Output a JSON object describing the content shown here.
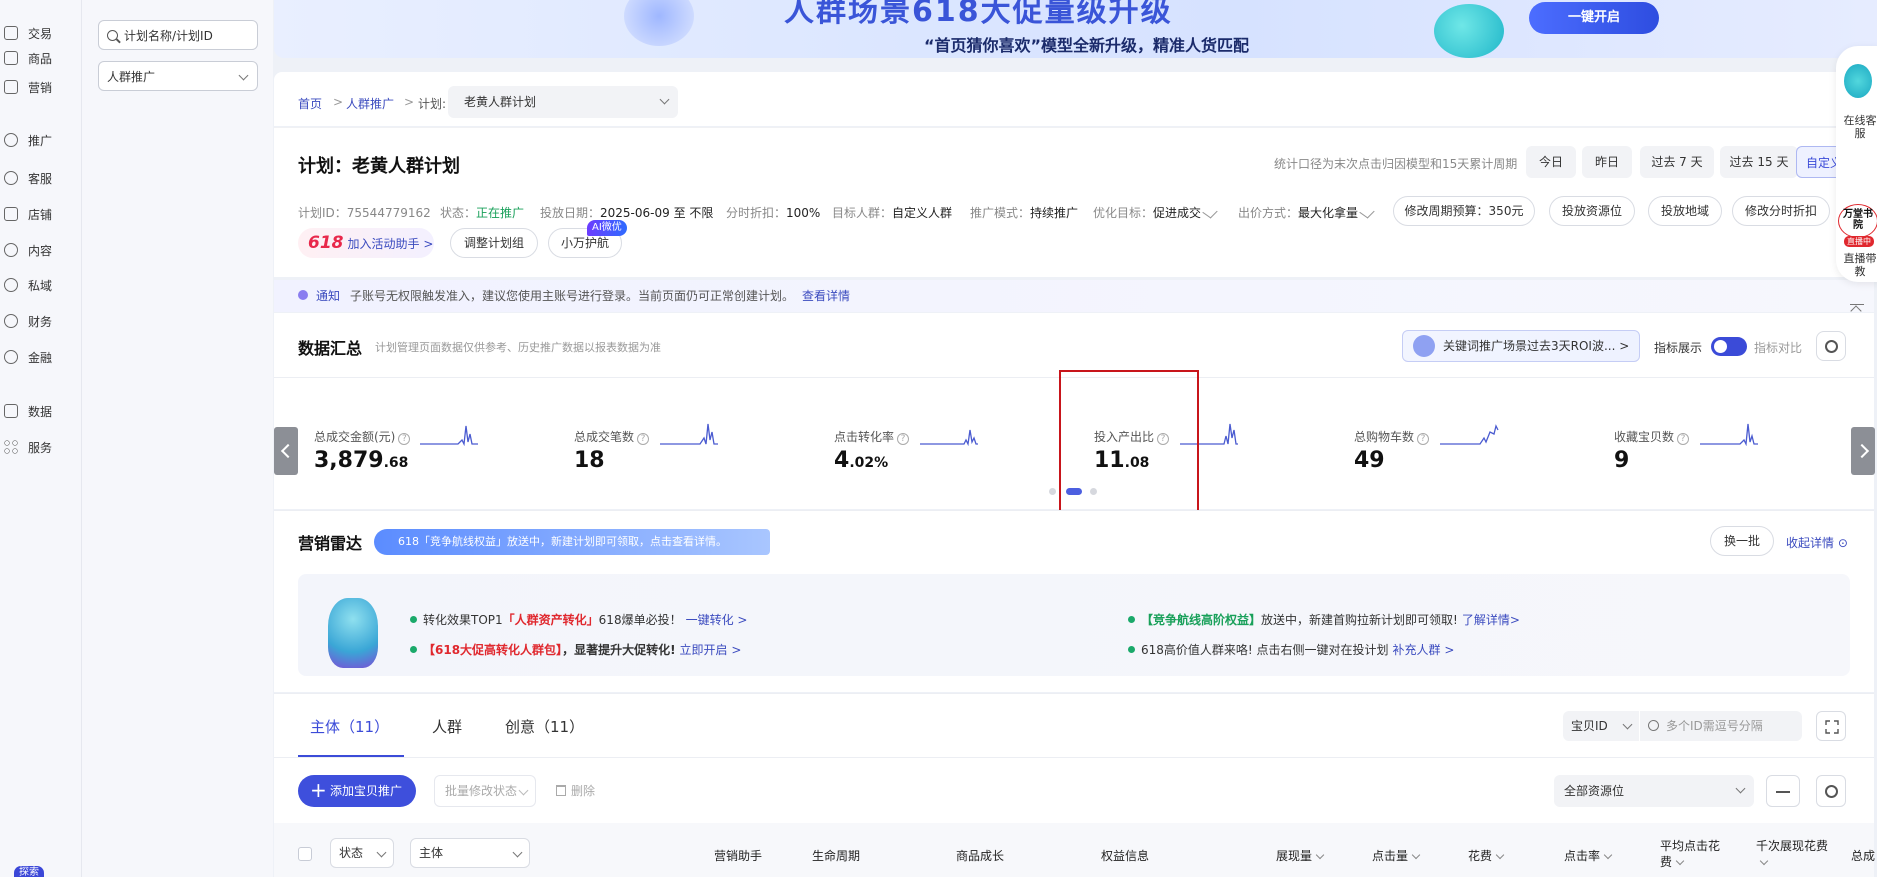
{
  "leftnav": {
    "items": [
      {
        "label": "交易",
        "icon": "receipt-icon"
      },
      {
        "label": "商品",
        "icon": "box-icon"
      },
      {
        "label": "营销",
        "icon": "megaphone-icon"
      },
      {
        "label": "推广",
        "icon": "location-icon"
      },
      {
        "label": "客服",
        "icon": "headset-icon"
      },
      {
        "label": "店铺",
        "icon": "store-icon"
      },
      {
        "label": "内容",
        "icon": "content-icon"
      },
      {
        "label": "私域",
        "icon": "chat-icon"
      },
      {
        "label": "财务",
        "icon": "yen-icon"
      },
      {
        "label": "金融",
        "icon": "finance-icon"
      },
      {
        "label": "数据",
        "icon": "chart-icon"
      },
      {
        "label": "服务",
        "icon": "grid-icon"
      }
    ],
    "bottom_badge": "探索"
  },
  "secnav": {
    "search_placeholder": "计划名称/计划ID",
    "scene_select": "人群推广"
  },
  "banner": {
    "headline": "人群场景618大促量级升级",
    "subline": "“首页猜你喜欢”模型全新升级，精准人货匹配",
    "cta": "一键开启"
  },
  "breadcrumb": {
    "home": "首页",
    "sep": ">",
    "scene": "人群推广",
    "plan_prefix": "计划:",
    "plan_name": "老黄人群计划"
  },
  "plan": {
    "title": "计划：老黄人群计划",
    "stats_hint": "统计口径为末次点击归因模型和15天累计周期",
    "date_buttons": [
      "今日",
      "昨日",
      "过去 7 天",
      "过去 15 天",
      "自定义"
    ],
    "meta": {
      "id_label": "计划ID：",
      "id": "75544779162",
      "status_label": "状态：",
      "status": "正在推广",
      "date_label": "投放日期：",
      "date": "2025-06-09 至 不限",
      "discount_label": "分时折扣：",
      "discount": "100%",
      "audience_label": "目标人群：",
      "audience": "自定义人群",
      "mode_label": "推广模式：",
      "mode": "持续推广",
      "goal_label": "优化目标：",
      "goal": "促进成交",
      "bid_label": "出价方式：",
      "bid": "最大化拿量"
    },
    "action_buttons": [
      "修改周期预算：350元",
      "投放资源位",
      "投放地域",
      "修改分时折扣"
    ],
    "activity_tag": "618",
    "activity_label": "加入活动助手 >",
    "adjust_group": "调整计划组",
    "escort": "小万护航",
    "ai_badge": "AI微优"
  },
  "notice": {
    "label": "通知",
    "text": "子账号无权限触发准入，建议您使用主账号进行登录。当前页面仍可正常创建计划。",
    "link": "查看详情"
  },
  "summary": {
    "title": "数据汇总",
    "hint": "计划管理页面数据仅供参考、历史推广数据以报表数据为准",
    "promo": "关键词推广场景过去3天ROI波... >",
    "toggle_label": "指标展示",
    "toggle_label2": "指标对比",
    "metrics": [
      {
        "label": "总成交金额(元)",
        "int": "3,879",
        "dec": ".68"
      },
      {
        "label": "总成交笔数",
        "int": "18",
        "dec": ""
      },
      {
        "label": "点击转化率",
        "int": "4",
        "dec": ".02%"
      },
      {
        "label": "投入产出比",
        "int": "11",
        "dec": ".08"
      },
      {
        "label": "总购物车数",
        "int": "49",
        "dec": ""
      },
      {
        "label": "收藏宝贝数",
        "int": "9",
        "dec": ""
      }
    ]
  },
  "radar": {
    "title": "营销雷达",
    "banner": "618「竞争航线权益」放送中，新建计划即可领取，点击查看详情。",
    "swap": "换一批",
    "collapse": "收起详情 ⊙",
    "tips": {
      "t1_pre": "转化效果TOP1",
      "t1_red": "「人群资产转化」",
      "t1_post": "618爆单必投！",
      "t1_link": "一键转化 >",
      "t2_red": "【618大促高转化人群包】",
      "t2_post": "，显著提升大促转化!",
      "t2_link": "立即开启 >",
      "t3_grn": "【竞争航线高阶权益】",
      "t3_post": "放送中，新建首购拉新计划即可领取!",
      "t3_link": "了解详情>",
      "t4_pre": "618高价值人群来咯! 点击右侧一键对在投计划",
      "t4_link": "补充人群 >"
    }
  },
  "table": {
    "tabs": [
      "主体（11）",
      "人群",
      "创意（11）"
    ],
    "id_select": "宝贝ID",
    "id_placeholder": "多个ID需逗号分隔",
    "add_button": "添加宝贝推广",
    "batch_button": "批量修改状态",
    "delete_button": "删除",
    "resource_select": "全部资源位",
    "status_select": "状态",
    "subject_select": "主体",
    "columns": [
      "营销助手",
      "生命周期",
      "商品成长",
      "权益信息",
      "展现量",
      "点击量",
      "花费",
      "点击率",
      "平均点击花费",
      "千次展现花费",
      "总成"
    ]
  },
  "float": {
    "service": "在线客服",
    "academy": "万堂书院",
    "live_badge": "直播中",
    "live_text": "直播带教"
  }
}
